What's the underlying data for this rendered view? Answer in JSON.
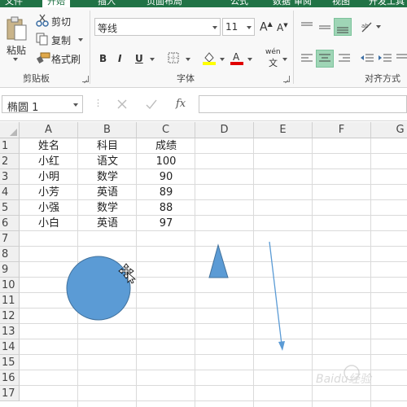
{
  "ribbon_tabs": [
    "文件",
    "开始",
    "插入",
    "页面布局",
    "公式",
    "数据",
    "审阅",
    "视图",
    "开发工具"
  ],
  "clipboard": {
    "paste_label": "粘贴",
    "cut_label": "剪切",
    "copy_label": "复制",
    "format_painter_label": "格式刷",
    "group_label": "剪贴板"
  },
  "font": {
    "name": "等线",
    "size": "11",
    "bold_label": "B",
    "italic_label": "I",
    "underline_label": "U",
    "phonetic_label": "wén",
    "group_label": "字体",
    "fill_color": "#ffff00",
    "text_color": "#e00000"
  },
  "alignment": {
    "group_label": "对齐方式"
  },
  "formula_bar": {
    "name_box": "椭圆 1",
    "fx_label": "fx",
    "formula": ""
  },
  "sheet": {
    "columns": [
      "A",
      "B",
      "C",
      "D",
      "E",
      "F",
      "G"
    ],
    "rows": [
      "1",
      "2",
      "3",
      "4",
      "5",
      "6",
      "7",
      "8",
      "9",
      "10",
      "11",
      "12",
      "13",
      "14",
      "15",
      "16",
      "17"
    ],
    "headers": [
      "姓名",
      "科目",
      "成绩"
    ],
    "data": [
      [
        "小红",
        "语文",
        "100"
      ],
      [
        "小明",
        "数学",
        "90"
      ],
      [
        "小芳",
        "英语",
        "89"
      ],
      [
        "小强",
        "数学",
        "88"
      ],
      [
        "小白",
        "英语",
        "97"
      ]
    ]
  },
  "shapes": {
    "circle_color": "#5b9bd5",
    "triangle_color": "#5b9bd5",
    "arrow_color": "#5b9bd5"
  },
  "watermark": "Baidu经验"
}
